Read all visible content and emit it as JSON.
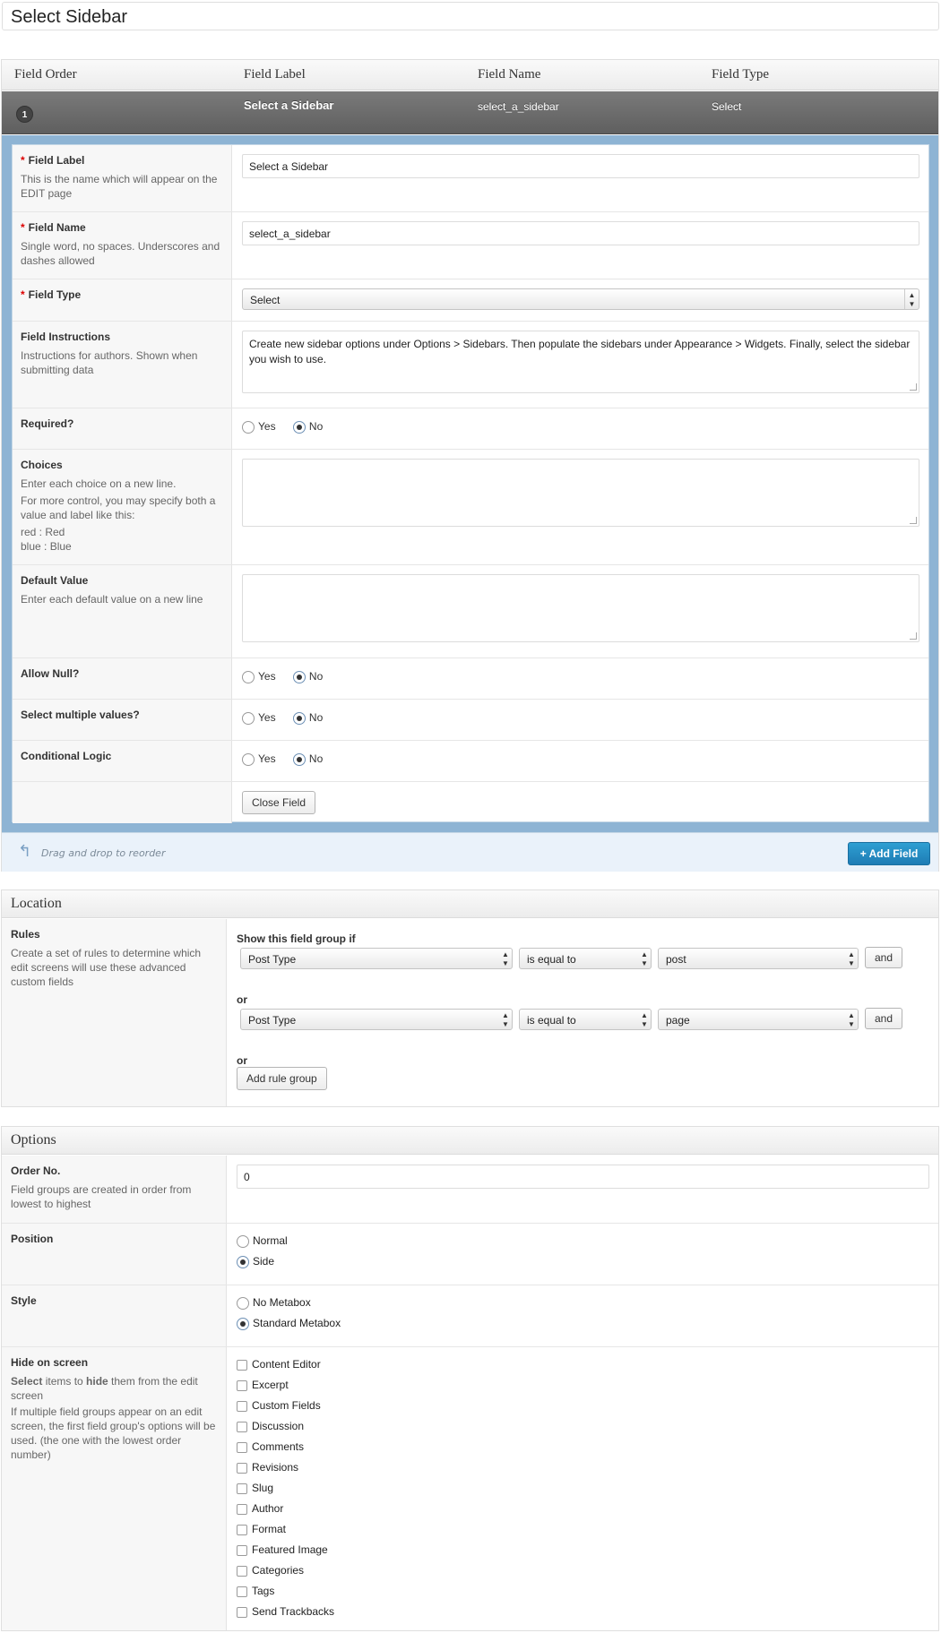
{
  "title": "Select Sidebar",
  "fields_header": {
    "order": "Field Order",
    "label": "Field Label",
    "name": "Field Name",
    "type": "Field Type"
  },
  "field_row": {
    "order": "1",
    "label": "Select a Sidebar",
    "name": "select_a_sidebar",
    "type": "Select"
  },
  "edit": {
    "field_label": {
      "title": "Field Label",
      "desc": "This is the name which will appear on the EDIT page",
      "value": "Select a Sidebar"
    },
    "field_name": {
      "title": "Field Name",
      "desc": "Single word, no spaces. Underscores and dashes allowed",
      "value": "select_a_sidebar"
    },
    "field_type": {
      "title": "Field Type",
      "value": "Select"
    },
    "instructions": {
      "title": "Field Instructions",
      "desc": "Instructions for authors. Shown when submitting data",
      "value": "Create new sidebar options under Options > Sidebars. Then populate the sidebars under Appearance > Widgets. Finally, select the sidebar you wish to use."
    },
    "required": {
      "title": "Required?",
      "yes": "Yes",
      "no": "No",
      "selected": "No"
    },
    "choices": {
      "title": "Choices",
      "desc1": "Enter each choice on a new line.",
      "desc2": "For more control, you may specify both a value and label like this:",
      "example1": "red : Red",
      "example2": "blue : Blue",
      "value": ""
    },
    "default_value": {
      "title": "Default Value",
      "desc": "Enter each default value on a new line",
      "value": ""
    },
    "allow_null": {
      "title": "Allow Null?",
      "yes": "Yes",
      "no": "No",
      "selected": "No"
    },
    "multiple": {
      "title": "Select multiple values?",
      "yes": "Yes",
      "no": "No",
      "selected": "No"
    },
    "conditional": {
      "title": "Conditional Logic",
      "yes": "Yes",
      "no": "No",
      "selected": "No"
    },
    "close_button": "Close Field"
  },
  "footer": {
    "drag_text": "Drag and drop to reorder",
    "add_button": "+ Add Field"
  },
  "location": {
    "heading": "Location",
    "rules_title": "Rules",
    "rules_desc": "Create a set of rules to determine which edit screens will use these advanced custom fields",
    "show_if": "Show this field group if",
    "groups": [
      {
        "param": "Post Type",
        "operator": "is equal to",
        "value": "post",
        "and": "and"
      },
      {
        "param": "Post Type",
        "operator": "is equal to",
        "value": "page",
        "and": "and"
      }
    ],
    "or1": "or",
    "or2": "or",
    "add_group": "Add rule group"
  },
  "options": {
    "heading": "Options",
    "order": {
      "title": "Order No.",
      "desc": "Field groups are created in order from lowest to highest",
      "value": "0"
    },
    "position": {
      "title": "Position",
      "choices": [
        "Normal",
        "Side"
      ],
      "selected": "Side"
    },
    "style": {
      "title": "Style",
      "choices": [
        "No Metabox",
        "Standard Metabox"
      ],
      "selected": "Standard Metabox"
    },
    "hide": {
      "title": "Hide on screen",
      "desc_select": "Select",
      "desc_mid": " items to ",
      "desc_hide": "hide",
      "desc_end": " them from the edit screen",
      "desc2": "If multiple field groups appear on an edit screen, the first field group's options will be used. (the one with the lowest order number)",
      "items": [
        "Content Editor",
        "Excerpt",
        "Custom Fields",
        "Discussion",
        "Comments",
        "Revisions",
        "Slug",
        "Author",
        "Format",
        "Featured Image",
        "Categories",
        "Tags",
        "Send Trackbacks"
      ]
    }
  }
}
